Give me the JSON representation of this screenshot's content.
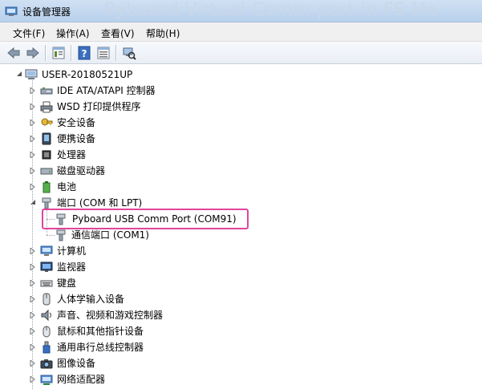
{
  "window": {
    "title": "设备管理器",
    "background_title": "Pyboard Virtual Comm port in FS Mo"
  },
  "menu": [
    "文件(F)",
    "操作(A)",
    "查看(V)",
    "帮助(H)"
  ],
  "toolbar": [
    "back-icon",
    "forward-icon",
    "properties-icon",
    "help-icon",
    "view-icon",
    "scan-hardware-icon"
  ],
  "tree": {
    "root": "USER-20180521UP",
    "categories": [
      {
        "label": "IDE ATA/ATAPI 控制器",
        "icon": "ide-controller-icon",
        "expanded": false
      },
      {
        "label": "WSD 打印提供程序",
        "icon": "printer-icon",
        "expanded": false
      },
      {
        "label": "安全设备",
        "icon": "security-key-icon",
        "expanded": false
      },
      {
        "label": "便携设备",
        "icon": "portable-device-icon",
        "expanded": false
      },
      {
        "label": "处理器",
        "icon": "processor-icon",
        "expanded": false
      },
      {
        "label": "磁盘驱动器",
        "icon": "disk-drive-icon",
        "expanded": false
      },
      {
        "label": "电池",
        "icon": "battery-icon",
        "expanded": false
      },
      {
        "label": "端口 (COM 和 LPT)",
        "icon": "port-icon",
        "expanded": true,
        "children": [
          {
            "label": "Pyboard USB Comm Port (COM91)",
            "icon": "port-icon",
            "highlighted": true
          },
          {
            "label": "通信端口 (COM1)",
            "icon": "port-icon",
            "highlighted": false
          }
        ]
      },
      {
        "label": "计算机",
        "icon": "computer-icon",
        "expanded": false
      },
      {
        "label": "监视器",
        "icon": "monitor-icon",
        "expanded": false
      },
      {
        "label": "键盘",
        "icon": "keyboard-icon",
        "expanded": false
      },
      {
        "label": "人体学输入设备",
        "icon": "hid-icon",
        "expanded": false
      },
      {
        "label": "声音、视频和游戏控制器",
        "icon": "speaker-icon",
        "expanded": false
      },
      {
        "label": "鼠标和其他指针设备",
        "icon": "mouse-icon",
        "expanded": false
      },
      {
        "label": "通用串行总线控制器",
        "icon": "usb-icon",
        "expanded": false
      },
      {
        "label": "图像设备",
        "icon": "camera-icon",
        "expanded": false
      },
      {
        "label": "网络适配器",
        "icon": "network-adapter-icon",
        "expanded": false
      }
    ]
  },
  "colors": {
    "highlight_border": "#e0459c",
    "title_bar": "#b9d1ec"
  }
}
